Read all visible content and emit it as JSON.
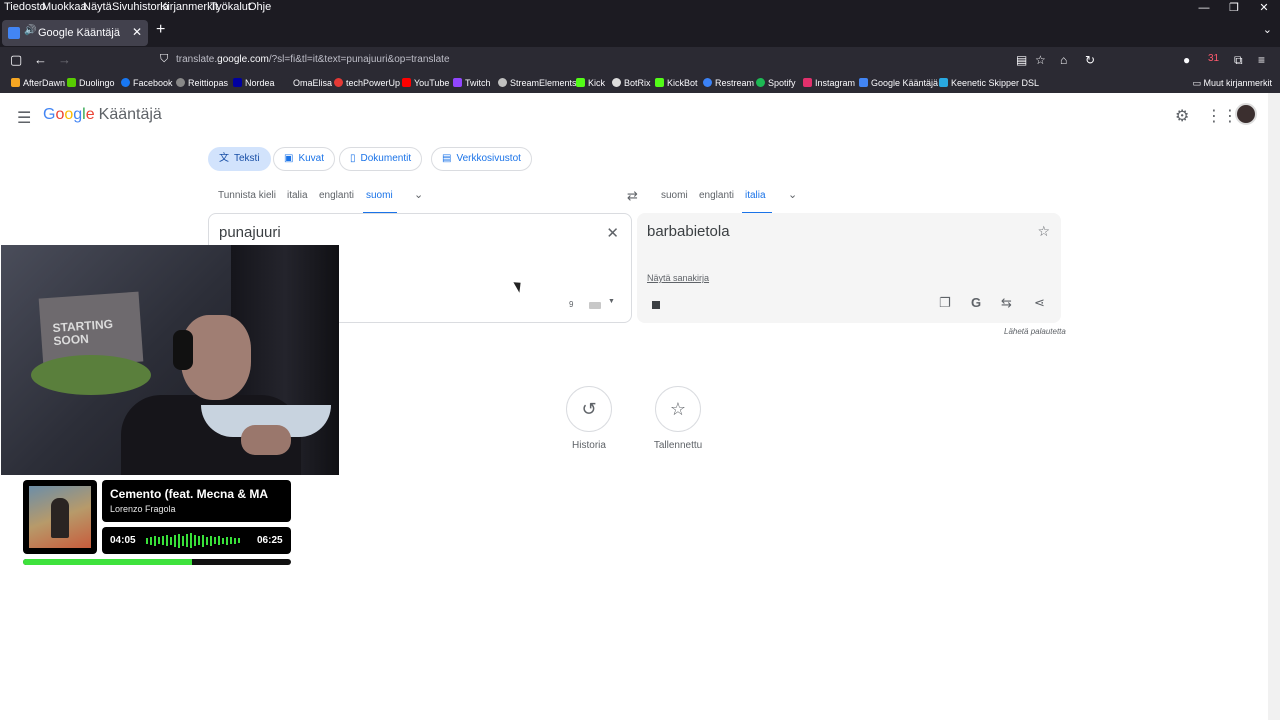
{
  "menubar": {
    "items": [
      "Tiedosto",
      "Muokkaa",
      "Näytä",
      "Sivuhistoria",
      "Kirjanmerkit",
      "Työkalut",
      "Ohje"
    ]
  },
  "tab": {
    "title": "Google Kääntäjä"
  },
  "address": {
    "url_prefix": "translate.",
    "url_domain": "google.com",
    "url_rest": "/?sl=fi&tl=it&text=punajuuri&op=translate"
  },
  "bookmarks": {
    "items": [
      "AfterDawn",
      "Duolingo",
      "Facebook",
      "Reittiopas",
      "Nordea",
      "OmaElisa",
      "techPowerUp",
      "YouTube",
      "Twitch",
      "StreamElements",
      "Kick",
      "BotRix",
      "KickBot",
      "Restream",
      "Spotify",
      "Instagram",
      "Google Kääntäjä",
      "Keenetic Skipper DSL"
    ],
    "other": "Muut kirjanmerkit",
    "notification_badge": "31"
  },
  "header": {
    "logo": [
      "G",
      "o",
      "o",
      "g",
      "l",
      "e"
    ],
    "product": "Kääntäjä"
  },
  "modes": [
    {
      "label": "Teksti",
      "active": true
    },
    {
      "label": "Kuvat",
      "active": false
    },
    {
      "label": "Dokumentit",
      "active": false
    },
    {
      "label": "Verkkosivustot",
      "active": false
    }
  ],
  "source_langs": [
    "Tunnista kieli",
    "italia",
    "englanti",
    "suomi"
  ],
  "source_active": "suomi",
  "target_langs": [
    "suomi",
    "englanti",
    "italia"
  ],
  "target_active": "italia",
  "source": {
    "text": "punajuuri",
    "char_count": "9"
  },
  "target": {
    "text": "barbabietola",
    "dict_link": "Näytä sanakirja"
  },
  "feedback": "Lähetä palautetta",
  "bottom_buttons": [
    {
      "label": "Historia",
      "icon": "history-icon"
    },
    {
      "label": "Tallennettu",
      "icon": "star-icon"
    }
  ],
  "webcam": {
    "poster_text": "STARTING\nSOON"
  },
  "music": {
    "title": "Cemento (feat. Mecna & MA",
    "artist": "Lorenzo Fragola",
    "elapsed": "04:05",
    "total": "06:25",
    "progress": 0.63
  },
  "colors": {
    "accent": "#1a73e8",
    "eq_green": "#39e03a"
  }
}
